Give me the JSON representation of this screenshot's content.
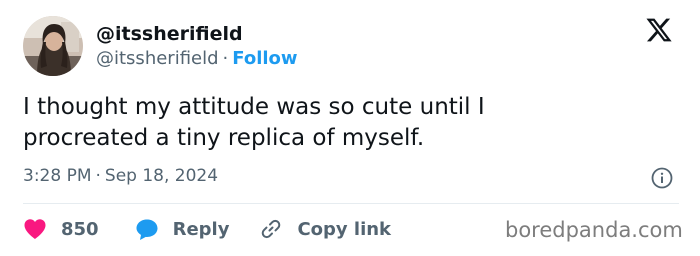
{
  "author": {
    "display_name": "@itssherifield",
    "handle": "@itssherifield",
    "separator": "·",
    "follow_label": "Follow",
    "avatar_icon": "profile-photo"
  },
  "tweet": {
    "text_lines": [
      "I thought my attitude was so cute until I",
      "procreated a tiny replica of myself."
    ]
  },
  "meta": {
    "time": "3:28 PM",
    "separator": "·",
    "date": "Sep 18, 2024"
  },
  "actions": {
    "likes_count": "850",
    "reply_label": "Reply",
    "copy_link_label": "Copy link"
  },
  "watermark": "boredpanda.com",
  "icons": {
    "brand": "x-logo-icon",
    "info": "info-icon",
    "like": "heart-icon",
    "reply": "speech-bubble-icon",
    "copy": "link-icon"
  },
  "colors": {
    "accent": "#1d9bf0",
    "like": "#f91880",
    "text": "#0f1419",
    "muted": "#536471"
  }
}
